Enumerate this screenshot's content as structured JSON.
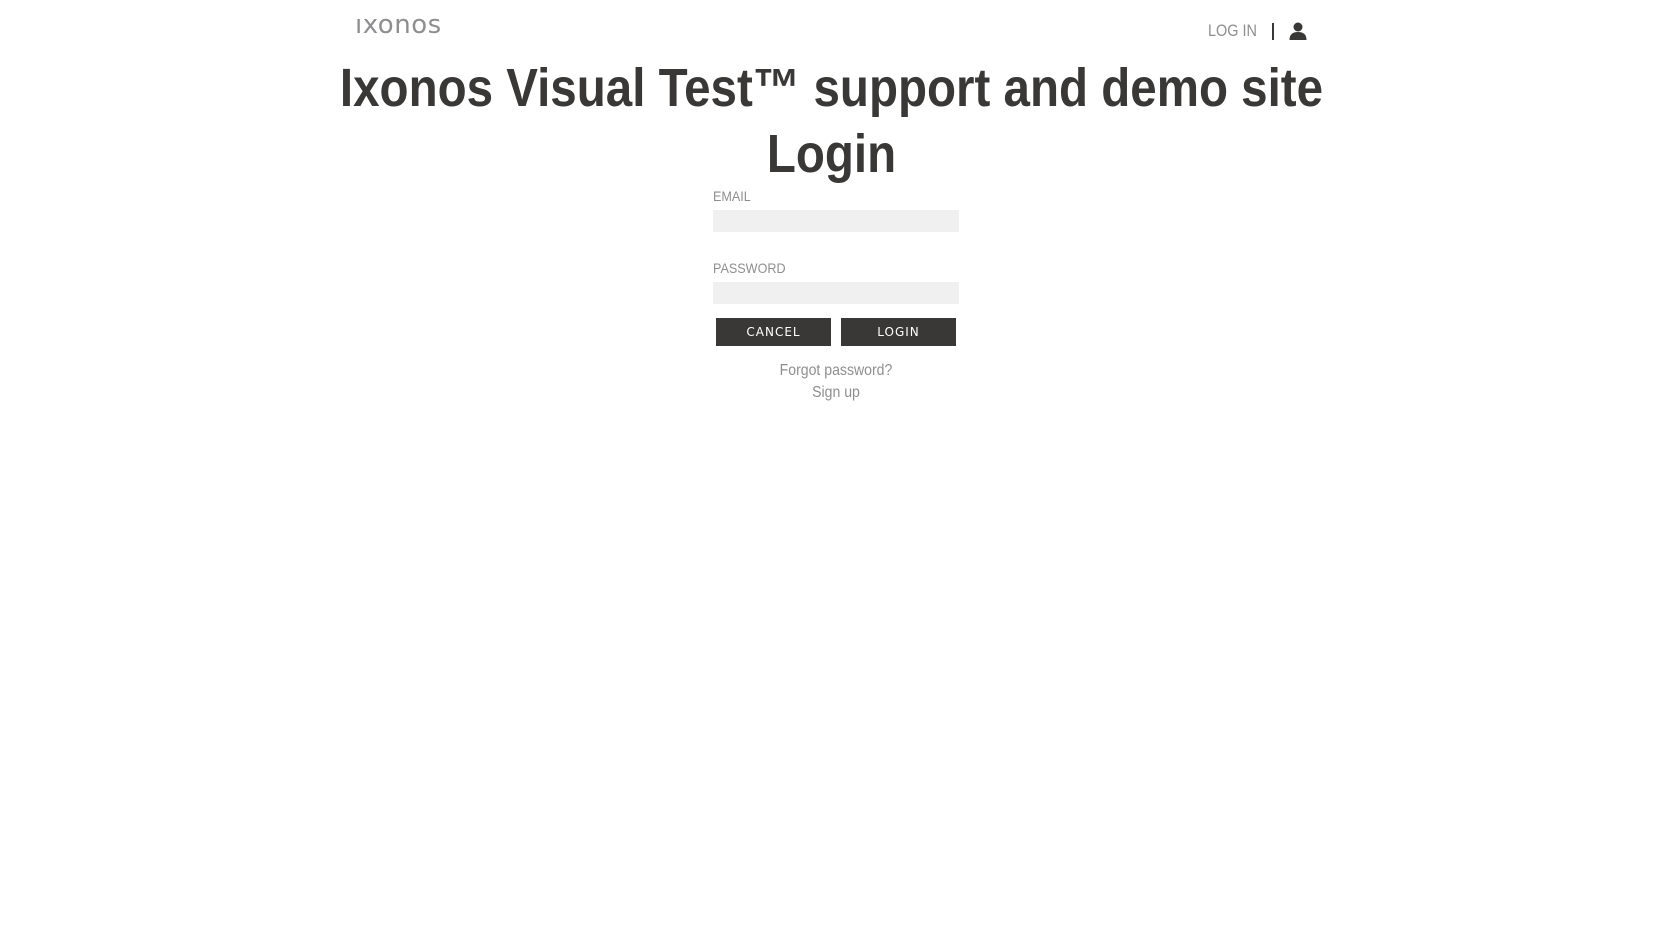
{
  "header": {
    "logo_text": "ıxonos",
    "login_link": "LOG IN",
    "user_icon": "user-icon"
  },
  "main": {
    "site_title": "Ixonos Visual Test™ support and demo site",
    "page_title": "Login"
  },
  "form": {
    "email_label": "EMAIL",
    "email_value": "",
    "password_label": "PASSWORD",
    "password_value": "",
    "cancel_label": "CANCEL",
    "login_label": "LOGIN",
    "forgot_password": "Forgot password?",
    "sign_up": "Sign up"
  },
  "colors": {
    "text_dark": "#3a3836",
    "text_muted": "#8e8e90",
    "input_bg": "#f0f0f0",
    "button_bg": "#3a3836",
    "button_text": "#ffffff"
  }
}
